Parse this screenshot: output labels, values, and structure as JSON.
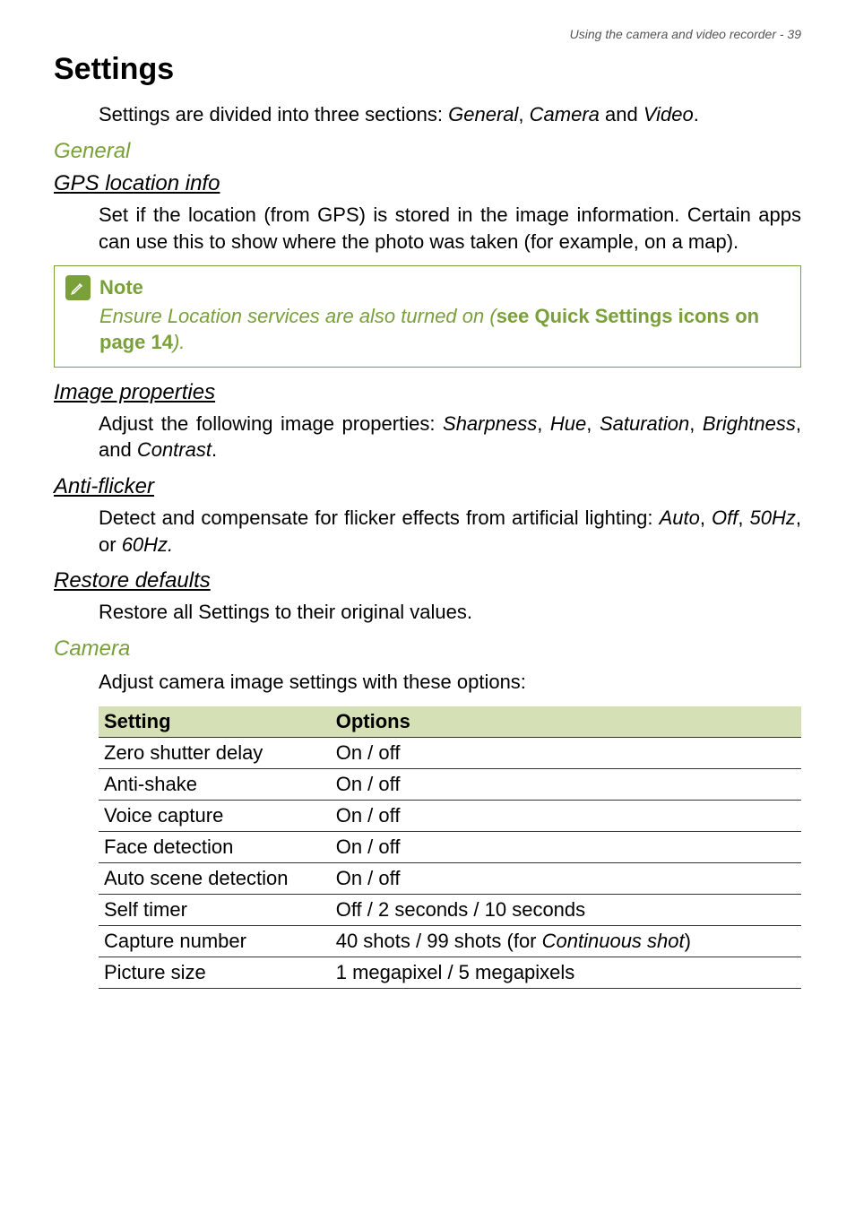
{
  "header": {
    "running_head": "Using the camera and video recorder - 39"
  },
  "title": "Settings",
  "intro": {
    "prefix": "Settings are divided into three sections: ",
    "g": "General",
    "sep1": ", ",
    "c": "Camera",
    "sep2": " and ",
    "v": "Video",
    "suffix": "."
  },
  "sections": {
    "general": {
      "label": "General",
      "gps": {
        "heading": "GPS location info",
        "body": "Set if the location (from GPS) is stored in the image information. Certain apps can use this to show where the photo was taken (for example, on a map)."
      },
      "note": {
        "title": "Note",
        "prefix": "Ensure Location services are also turned on (",
        "link": "see Quick Settings icons on page 14",
        "suffix": ")."
      },
      "image_props": {
        "heading": "Image properties",
        "prefix": "Adjust the following image properties: ",
        "p1": "Sharpness",
        "s1": ", ",
        "p2": "Hue",
        "s2": ", ",
        "p3": "Saturation",
        "s3": ", ",
        "p4": "Brightness",
        "s4": ", and ",
        "p5": "Contrast",
        "suffix": "."
      },
      "anti_flicker": {
        "heading": "Anti-flicker",
        "prefix": "Detect and compensate for flicker effects from artificial lighting: ",
        "o1": "Auto",
        "s1": ", ",
        "o2": "Off",
        "s2": ", ",
        "o3": "50Hz",
        "s3": ", or ",
        "o4": "60Hz.",
        "suffix": ""
      },
      "restore": {
        "heading": "Restore defaults",
        "body": "Restore all Settings to their original values."
      }
    },
    "camera": {
      "label": "Camera",
      "intro": "Adjust camera image settings with these options:",
      "table": {
        "head_setting": "Setting",
        "head_options": "Options",
        "rows": [
          {
            "setting": "Zero shutter delay",
            "options": "On / off"
          },
          {
            "setting": "Anti-shake",
            "options": "On / off"
          },
          {
            "setting": "Voice capture",
            "options": "On / off"
          },
          {
            "setting": "Face detection",
            "options": "On / off"
          },
          {
            "setting": "Auto scene detection",
            "options": "On / off"
          },
          {
            "setting": "Self timer",
            "options": "Off / 2 seconds / 10 seconds"
          }
        ],
        "row_capture": {
          "setting": "Capture number",
          "prefix": "40 shots / 99 shots (for ",
          "italic": "Continuous shot",
          "suffix": ")"
        },
        "row_picsize": {
          "setting": "Picture size",
          "options": "1 megapixel / 5 megapixels"
        }
      }
    }
  }
}
